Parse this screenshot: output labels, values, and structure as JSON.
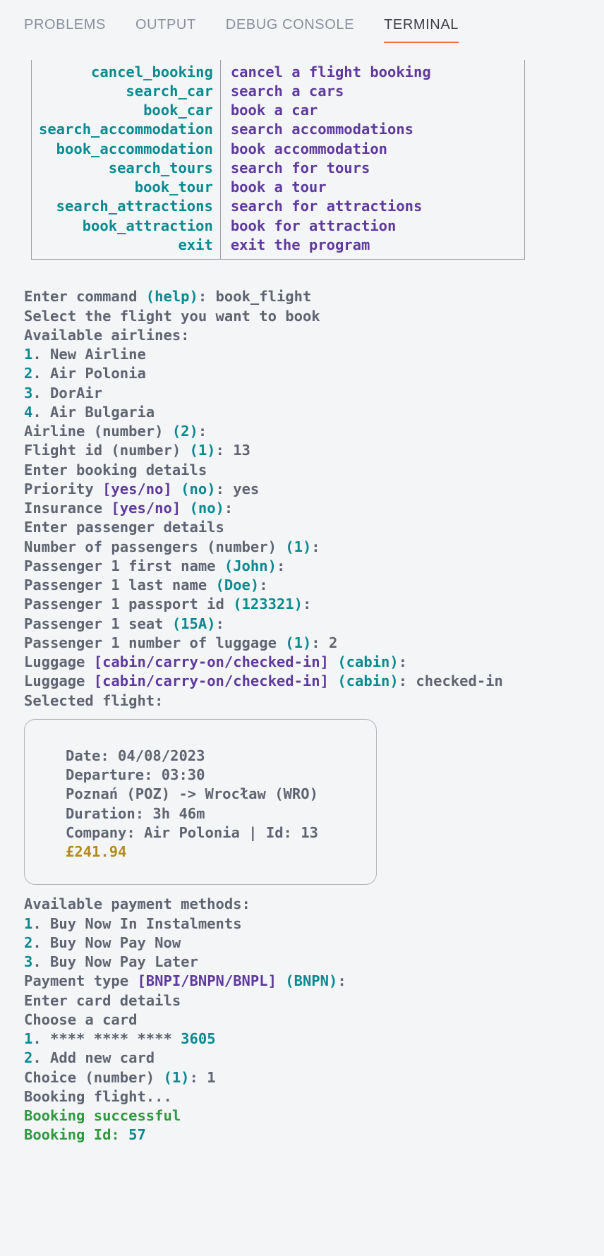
{
  "tabs": {
    "problems": "PROBLEMS",
    "output": "OUTPUT",
    "debug": "DEBUG CONSOLE",
    "terminal": "TERMINAL"
  },
  "commands": [
    {
      "cmd": "cancel_booking",
      "desc": "cancel a flight booking"
    },
    {
      "cmd": "search_car",
      "desc": "search a cars"
    },
    {
      "cmd": "book_car",
      "desc": "book a car"
    },
    {
      "cmd": "search_accommodation",
      "desc": "search accommodations"
    },
    {
      "cmd": "book_accommodation",
      "desc": "book accommodation"
    },
    {
      "cmd": "search_tours",
      "desc": "search for tours"
    },
    {
      "cmd": "book_tour",
      "desc": "book a tour"
    },
    {
      "cmd": "search_attractions",
      "desc": "search for attractions"
    },
    {
      "cmd": "book_attraction",
      "desc": "book for attraction"
    },
    {
      "cmd": "exit",
      "desc": "exit the program"
    }
  ],
  "session": {
    "enter_cmd": "Enter command ",
    "help": "(help)",
    "colon": ": ",
    "book_flight": "book_flight",
    "select_flight": "Select the flight you want to book",
    "avail_airlines": "Available airlines:",
    "a1n": "1",
    "a1": ". New Airline",
    "a2n": "2",
    "a2": ". Air Polonia",
    "a3n": "3",
    "a3": ". DorAir",
    "a4n": "4",
    "a4": ". Air Bulgaria",
    "airline_prompt": "Airline (number) ",
    "def2": "(2)",
    "flight_id_prompt": "Flight id (number) ",
    "def1": "(1)",
    "flight_id_val": " 13",
    "enter_booking": "Enter booking details",
    "priority": "Priority ",
    "yesno": "[yes/no]",
    "defno": " (no)",
    "yes_val": " yes",
    "insurance": "Insurance ",
    "enter_passenger": "Enter passenger details",
    "num_passengers": "Number of passengers (number) ",
    "p1_first": "Passenger 1 first name ",
    "john": "(John)",
    "p1_last": "Passenger 1 last name ",
    "doe": "(Doe)",
    "p1_passport": "Passenger 1 passport id ",
    "passport_def": "(123321)",
    "p1_seat": "Passenger 1 seat ",
    "seat_def": "(15A)",
    "p1_luggage": "Passenger 1 number of luggage ",
    "luggage_def": "(1)",
    "luggage_val": " 2",
    "luggage_prompt": "Luggage ",
    "luggage_opts": "[cabin/carry-on/checked-in]",
    "cabin_def": " (cabin)",
    "checked_in_val": " checked-in",
    "selected_flight": "Selected flight:",
    "flight": {
      "date": "Date: 04/08/2023",
      "departure": "Departure: 03:30",
      "route": "Poznań (POZ) -> Wrocław (WRO)",
      "duration": "Duration: 3h 46m",
      "company": "Company: Air Polonia | Id: 13",
      "price": "£241.94"
    },
    "avail_payment": "Available payment methods:",
    "pm1n": "1",
    "pm1": ". Buy Now In Instalments",
    "pm2n": "2",
    "pm2": ". Buy Now Pay Now",
    "pm3n": "3",
    "pm3": ". Buy Now Pay Later",
    "payment_type": "Payment type ",
    "payment_opts": "[BNPI/BNPN/BNPL]",
    "bnpn_def": " (BNPN)",
    "enter_card": "Enter card details",
    "choose_card": "Choose a card",
    "c1n": "1",
    "c1_dots": ". **** **** **** ",
    "c1_last4": "3605",
    "c2n": "2",
    "c2": ". Add new card",
    "choice_prompt": "Choice (number) ",
    "choice_val": " 1",
    "booking_flight": "Booking flight...",
    "booking_success": "Booking successful",
    "booking_id_label": "Booking Id: ",
    "booking_id_val": "57"
  }
}
